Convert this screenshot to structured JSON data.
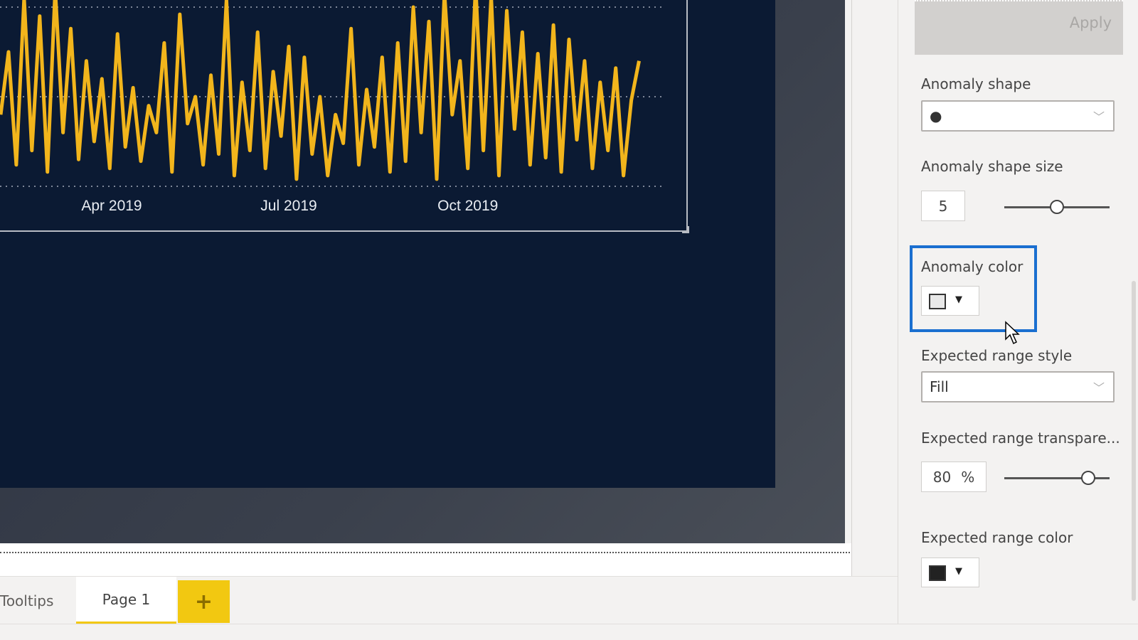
{
  "chart_data": {
    "type": "line",
    "title": "",
    "xlabel": "",
    "ylabel": "",
    "x_tick_labels": [
      "Apr 2019",
      "Jul 2019",
      "Oct 2019"
    ],
    "ylim": [
      0,
      100
    ],
    "grid": true,
    "line_color": "#f2b51c",
    "x": [
      "2019-02-03",
      "2019-02-07",
      "2019-02-11",
      "2019-02-15",
      "2019-02-19",
      "2019-02-23",
      "2019-02-27",
      "2019-03-03",
      "2019-03-07",
      "2019-03-11",
      "2019-03-15",
      "2019-03-19",
      "2019-03-23",
      "2019-03-27",
      "2019-03-31",
      "2019-04-04",
      "2019-04-08",
      "2019-04-12",
      "2019-04-16",
      "2019-04-20",
      "2019-04-24",
      "2019-04-28",
      "2019-05-02",
      "2019-05-06",
      "2019-05-10",
      "2019-05-14",
      "2019-05-18",
      "2019-05-22",
      "2019-05-26",
      "2019-05-30",
      "2019-06-03",
      "2019-06-07",
      "2019-06-11",
      "2019-06-15",
      "2019-06-19",
      "2019-06-23",
      "2019-06-27",
      "2019-07-01",
      "2019-07-05",
      "2019-07-09",
      "2019-07-13",
      "2019-07-17",
      "2019-07-21",
      "2019-07-25",
      "2019-07-29",
      "2019-08-02",
      "2019-08-06",
      "2019-08-10",
      "2019-08-14",
      "2019-08-18",
      "2019-08-22",
      "2019-08-26",
      "2019-08-30",
      "2019-09-03",
      "2019-09-07",
      "2019-09-11",
      "2019-09-15",
      "2019-09-19",
      "2019-09-23",
      "2019-09-27",
      "2019-10-01",
      "2019-10-05",
      "2019-10-09",
      "2019-10-13",
      "2019-10-17",
      "2019-10-21",
      "2019-10-25",
      "2019-10-29",
      "2019-11-02",
      "2019-11-06",
      "2019-11-10",
      "2019-11-14",
      "2019-11-18",
      "2019-11-22",
      "2019-11-26",
      "2019-11-30",
      "2019-12-04",
      "2019-12-08",
      "2019-12-12",
      "2019-12-16",
      "2019-12-20",
      "2019-12-24",
      "2019-12-28"
    ],
    "values": [
      40,
      75,
      12,
      105,
      20,
      95,
      8,
      110,
      30,
      88,
      15,
      70,
      25,
      60,
      10,
      85,
      22,
      55,
      14,
      45,
      30,
      80,
      8,
      96,
      35,
      50,
      12,
      62,
      18,
      104,
      6,
      58,
      20,
      86,
      10,
      64,
      28,
      78,
      4,
      72,
      18,
      50,
      6,
      40,
      24,
      88,
      12,
      54,
      22,
      72,
      8,
      80,
      14,
      100,
      30,
      92,
      4,
      108,
      40,
      70,
      10,
      112,
      20,
      106,
      6,
      98,
      32,
      86,
      12,
      74,
      16,
      90,
      8,
      82,
      26,
      70,
      10,
      58,
      20,
      66,
      6,
      48,
      70
    ]
  },
  "tabs": [
    {
      "label": "Tooltips"
    },
    {
      "label": "Page 1"
    }
  ],
  "add_page_label": "+",
  "pane": {
    "apply_label": "Apply",
    "anomaly_shape": {
      "label": "Anomaly shape",
      "value": "●"
    },
    "anomaly_shape_size": {
      "label": "Anomaly shape size",
      "value": "5",
      "slider_fraction": 0.5
    },
    "anomaly_color": {
      "label": "Anomaly color",
      "color": "#e8e8e8"
    },
    "expected_range_style": {
      "label": "Expected range style",
      "value": "Fill"
    },
    "expected_range_transparency": {
      "label": "Expected range transpare...",
      "value": "80",
      "unit": "%",
      "slider_fraction": 0.8
    },
    "expected_range_color": {
      "label": "Expected range color",
      "color": "#222222"
    }
  },
  "colors": {
    "accent": "#f2c811",
    "highlight": "#1a6fd0",
    "report_bg": "#0b1a33"
  }
}
